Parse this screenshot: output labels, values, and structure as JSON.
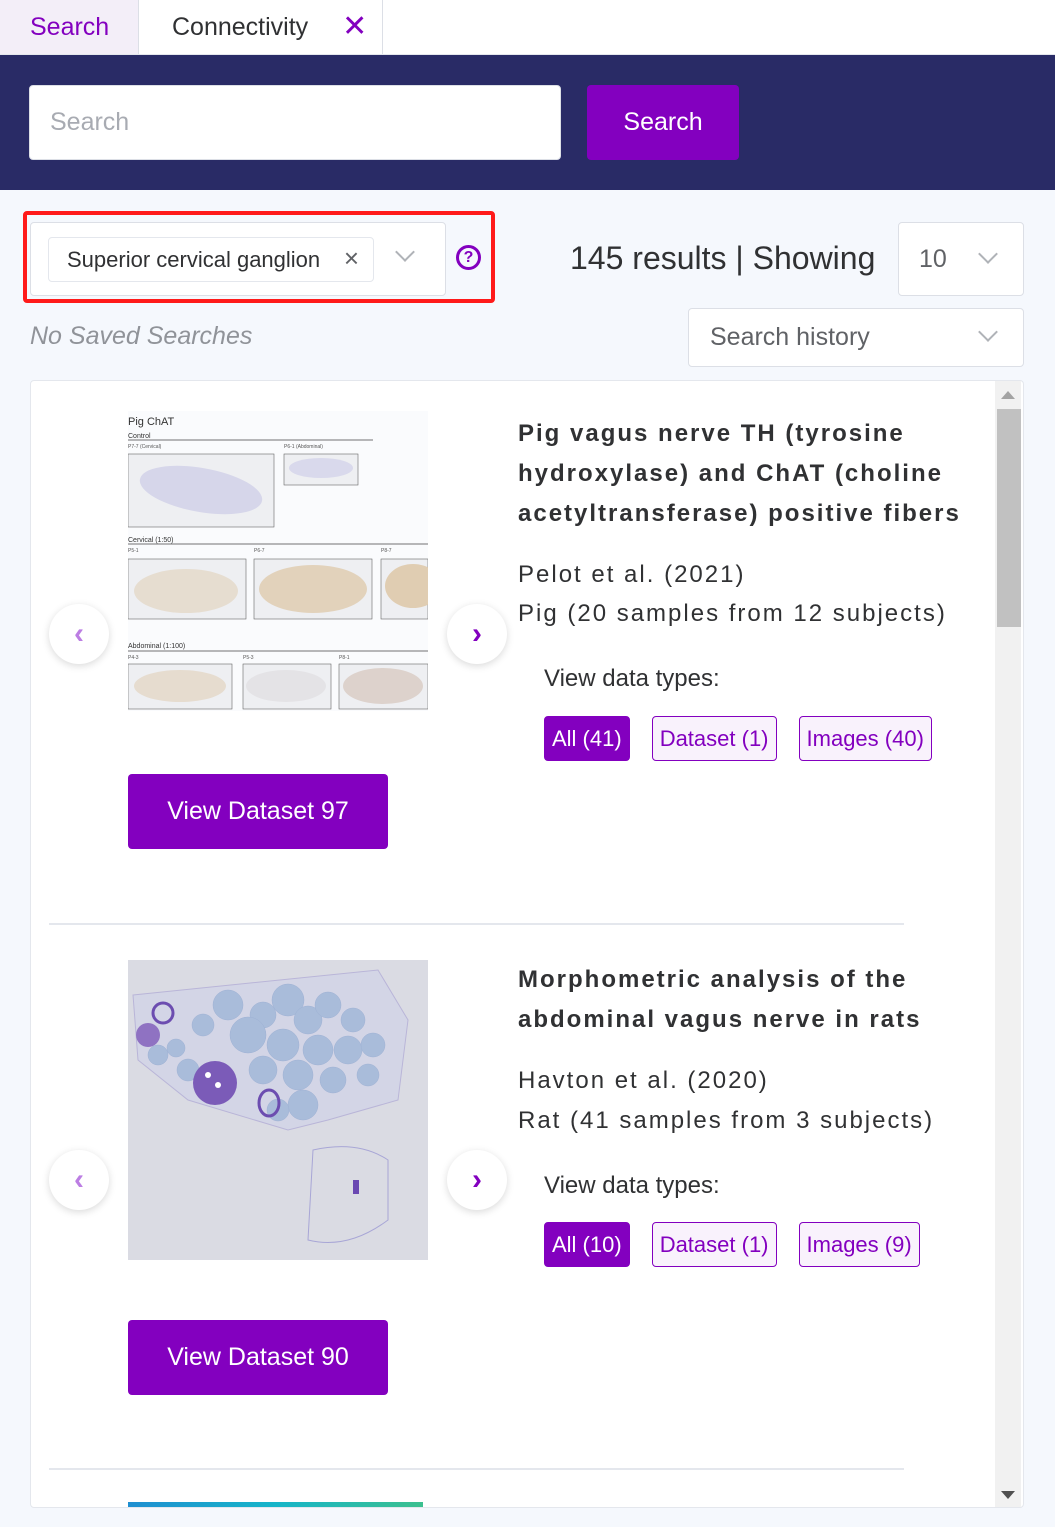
{
  "tabs": [
    {
      "label": "Search",
      "active": true
    },
    {
      "label": "Connectivity",
      "active": false,
      "closable": true
    }
  ],
  "header": {
    "search_placeholder": "Search",
    "search_value": "",
    "search_button_label": "Search"
  },
  "filters": {
    "selected_tag": "Superior cervical ganglion",
    "help_icon": "question-circle-icon",
    "no_saved_searches": "No Saved Searches"
  },
  "results_summary": {
    "text": "145 results | Showing",
    "total": 145,
    "per_page": "10",
    "search_history_placeholder": "Search history"
  },
  "results": [
    {
      "title": "Pig vagus nerve TH (tyrosine hydroxylase) and ChAT (choline acetyltransferase) positive fibers",
      "authors": "Pelot et al. (2021)",
      "species_samples": "Pig (20 samples from 12 subjects)",
      "view_data_types_label": "View data types:",
      "data_types": [
        {
          "label": "All (41)",
          "active": true
        },
        {
          "label": "Dataset (1)",
          "active": false
        },
        {
          "label": "Images (40)",
          "active": false
        }
      ],
      "view_button_label": "View Dataset 97",
      "thumbnail": {
        "heading": "Pig ChAT",
        "sections": [
          {
            "label": "Control",
            "panels": [
              "P7-7 (Cervical)",
              "P6-1 (Abdominal)"
            ]
          },
          {
            "label": "Cervical (1:50)",
            "panels": [
              "P5-1",
              "P6-7",
              "P8-7"
            ]
          },
          {
            "label": "Abdominal (1:100)",
            "panels": [
              "P4-3",
              "P5-3",
              "P8-1"
            ]
          }
        ]
      }
    },
    {
      "title": "Morphometric analysis of the abdominal vagus nerve in rats",
      "authors": "Havton et al. (2020)",
      "species_samples": "Rat (41 samples from 3 subjects)",
      "view_data_types_label": "View data types:",
      "data_types": [
        {
          "label": "All (10)",
          "active": true
        },
        {
          "label": "Dataset (1)",
          "active": false
        },
        {
          "label": "Images (9)",
          "active": false
        }
      ],
      "view_button_label": "View Dataset 90"
    }
  ],
  "icons": {
    "prev": "‹",
    "next": "›",
    "close": "✕",
    "tag_close": "×",
    "help": "?"
  },
  "colors": {
    "accent": "#8300bf",
    "header_bg": "#292b66",
    "highlight": "#ff1a1a"
  }
}
